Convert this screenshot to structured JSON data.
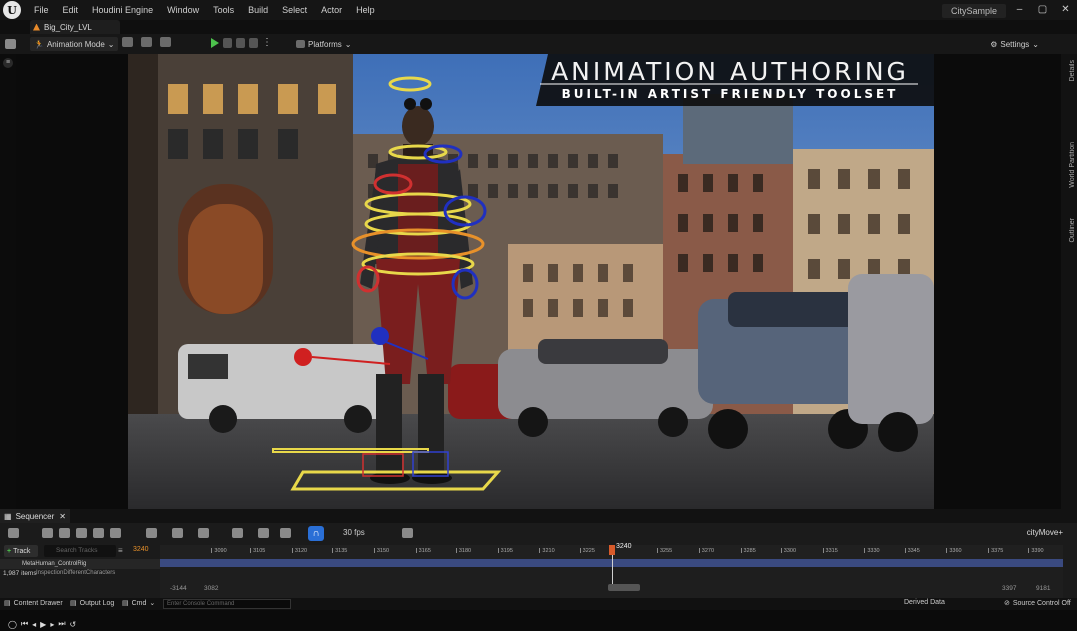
{
  "menubar": {
    "items": [
      "File",
      "Edit",
      "Houdini Engine",
      "Window",
      "Tools",
      "Build",
      "Select",
      "Actor",
      "Help"
    ],
    "project": "CitySample",
    "logo_letter": "U"
  },
  "tab": {
    "label": "Big_City_LVL"
  },
  "toolbar": {
    "mode": "Animation Mode",
    "platforms": "Platforms",
    "settings": "Settings"
  },
  "side_panels": {
    "details": "Details",
    "world_partition": "World Partition",
    "outliner": "Outliner"
  },
  "banner": {
    "title": "ANIMATION AUTHORING",
    "subtitle": "BUILT-IN ARTIST FRIENDLY TOOLSET"
  },
  "sequencer": {
    "tab": "Sequencer",
    "fps": "30 fps",
    "sequence_name": "cityMove+",
    "add_track": "Track",
    "search_placeholder": "Search Tracks",
    "current_frame": "3240",
    "tracks": [
      "MetaHuman_ControlRig",
      "InspectionDifferentCharacters"
    ],
    "item_count": "1,987 items",
    "ticks": [
      "3090",
      "3105",
      "3120",
      "3135",
      "3150",
      "3165",
      "3180",
      "3195",
      "3210",
      "3225",
      "3255",
      "3270",
      "3285",
      "3300",
      "3315",
      "3330",
      "3345",
      "3360",
      "3375",
      "3390"
    ],
    "range_start": "-3144",
    "range_start2": "3082",
    "range_end": "3397",
    "range_end2": "9181"
  },
  "status": {
    "content_drawer": "Content Drawer",
    "output_log": "Output Log",
    "cmd": "Cmd",
    "console_placeholder": "Enter Console Command",
    "derived_data": "Derived Data",
    "source_control": "Source Control Off"
  }
}
